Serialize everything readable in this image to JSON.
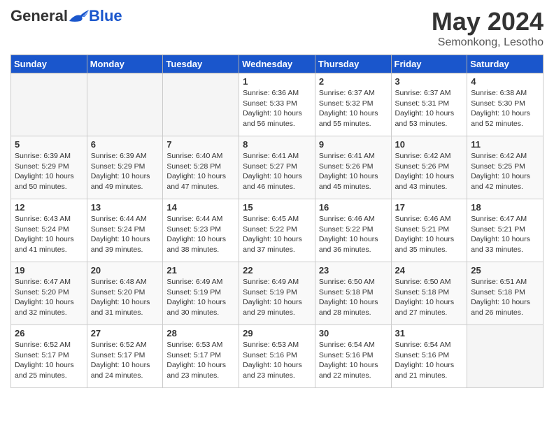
{
  "header": {
    "logo_general": "General",
    "logo_blue": "Blue",
    "title": "May 2024",
    "subtitle": "Semonkong, Lesotho"
  },
  "weekdays": [
    "Sunday",
    "Monday",
    "Tuesday",
    "Wednesday",
    "Thursday",
    "Friday",
    "Saturday"
  ],
  "weeks": [
    [
      {
        "day": "",
        "info": ""
      },
      {
        "day": "",
        "info": ""
      },
      {
        "day": "",
        "info": ""
      },
      {
        "day": "1",
        "info": "Sunrise: 6:36 AM\nSunset: 5:33 PM\nDaylight: 10 hours\nand 56 minutes."
      },
      {
        "day": "2",
        "info": "Sunrise: 6:37 AM\nSunset: 5:32 PM\nDaylight: 10 hours\nand 55 minutes."
      },
      {
        "day": "3",
        "info": "Sunrise: 6:37 AM\nSunset: 5:31 PM\nDaylight: 10 hours\nand 53 minutes."
      },
      {
        "day": "4",
        "info": "Sunrise: 6:38 AM\nSunset: 5:30 PM\nDaylight: 10 hours\nand 52 minutes."
      }
    ],
    [
      {
        "day": "5",
        "info": "Sunrise: 6:39 AM\nSunset: 5:29 PM\nDaylight: 10 hours\nand 50 minutes."
      },
      {
        "day": "6",
        "info": "Sunrise: 6:39 AM\nSunset: 5:29 PM\nDaylight: 10 hours\nand 49 minutes."
      },
      {
        "day": "7",
        "info": "Sunrise: 6:40 AM\nSunset: 5:28 PM\nDaylight: 10 hours\nand 47 minutes."
      },
      {
        "day": "8",
        "info": "Sunrise: 6:41 AM\nSunset: 5:27 PM\nDaylight: 10 hours\nand 46 minutes."
      },
      {
        "day": "9",
        "info": "Sunrise: 6:41 AM\nSunset: 5:26 PM\nDaylight: 10 hours\nand 45 minutes."
      },
      {
        "day": "10",
        "info": "Sunrise: 6:42 AM\nSunset: 5:26 PM\nDaylight: 10 hours\nand 43 minutes."
      },
      {
        "day": "11",
        "info": "Sunrise: 6:42 AM\nSunset: 5:25 PM\nDaylight: 10 hours\nand 42 minutes."
      }
    ],
    [
      {
        "day": "12",
        "info": "Sunrise: 6:43 AM\nSunset: 5:24 PM\nDaylight: 10 hours\nand 41 minutes."
      },
      {
        "day": "13",
        "info": "Sunrise: 6:44 AM\nSunset: 5:24 PM\nDaylight: 10 hours\nand 39 minutes."
      },
      {
        "day": "14",
        "info": "Sunrise: 6:44 AM\nSunset: 5:23 PM\nDaylight: 10 hours\nand 38 minutes."
      },
      {
        "day": "15",
        "info": "Sunrise: 6:45 AM\nSunset: 5:22 PM\nDaylight: 10 hours\nand 37 minutes."
      },
      {
        "day": "16",
        "info": "Sunrise: 6:46 AM\nSunset: 5:22 PM\nDaylight: 10 hours\nand 36 minutes."
      },
      {
        "day": "17",
        "info": "Sunrise: 6:46 AM\nSunset: 5:21 PM\nDaylight: 10 hours\nand 35 minutes."
      },
      {
        "day": "18",
        "info": "Sunrise: 6:47 AM\nSunset: 5:21 PM\nDaylight: 10 hours\nand 33 minutes."
      }
    ],
    [
      {
        "day": "19",
        "info": "Sunrise: 6:47 AM\nSunset: 5:20 PM\nDaylight: 10 hours\nand 32 minutes."
      },
      {
        "day": "20",
        "info": "Sunrise: 6:48 AM\nSunset: 5:20 PM\nDaylight: 10 hours\nand 31 minutes."
      },
      {
        "day": "21",
        "info": "Sunrise: 6:49 AM\nSunset: 5:19 PM\nDaylight: 10 hours\nand 30 minutes."
      },
      {
        "day": "22",
        "info": "Sunrise: 6:49 AM\nSunset: 5:19 PM\nDaylight: 10 hours\nand 29 minutes."
      },
      {
        "day": "23",
        "info": "Sunrise: 6:50 AM\nSunset: 5:18 PM\nDaylight: 10 hours\nand 28 minutes."
      },
      {
        "day": "24",
        "info": "Sunrise: 6:50 AM\nSunset: 5:18 PM\nDaylight: 10 hours\nand 27 minutes."
      },
      {
        "day": "25",
        "info": "Sunrise: 6:51 AM\nSunset: 5:18 PM\nDaylight: 10 hours\nand 26 minutes."
      }
    ],
    [
      {
        "day": "26",
        "info": "Sunrise: 6:52 AM\nSunset: 5:17 PM\nDaylight: 10 hours\nand 25 minutes."
      },
      {
        "day": "27",
        "info": "Sunrise: 6:52 AM\nSunset: 5:17 PM\nDaylight: 10 hours\nand 24 minutes."
      },
      {
        "day": "28",
        "info": "Sunrise: 6:53 AM\nSunset: 5:17 PM\nDaylight: 10 hours\nand 23 minutes."
      },
      {
        "day": "29",
        "info": "Sunrise: 6:53 AM\nSunset: 5:16 PM\nDaylight: 10 hours\nand 23 minutes."
      },
      {
        "day": "30",
        "info": "Sunrise: 6:54 AM\nSunset: 5:16 PM\nDaylight: 10 hours\nand 22 minutes."
      },
      {
        "day": "31",
        "info": "Sunrise: 6:54 AM\nSunset: 5:16 PM\nDaylight: 10 hours\nand 21 minutes."
      },
      {
        "day": "",
        "info": ""
      }
    ]
  ]
}
